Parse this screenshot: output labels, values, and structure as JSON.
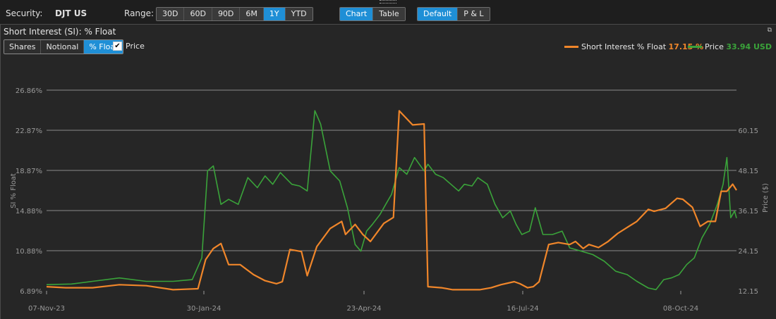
{
  "toolbar": {
    "security_label": "Security:",
    "security_value": "DJT US",
    "range_label": "Range:",
    "ranges": [
      "30D",
      "60D",
      "90D",
      "6M",
      "1Y",
      "YTD"
    ],
    "range_active": "1Y",
    "views": [
      "Chart",
      "Table"
    ],
    "view_active": "Chart",
    "modes": [
      "Default",
      "P & L"
    ],
    "mode_active": "Default"
  },
  "panel": {
    "title": "Short Interest (SI): % Float",
    "measure_buttons": [
      "Shares",
      "Notional",
      "% Float"
    ],
    "measure_active": "% Float",
    "price_checkbox_label": "Price",
    "price_checked": true,
    "restore_icon": "restore-window-icon"
  },
  "legend": {
    "si_label": "Short Interest % Float",
    "si_value": "17.15 %",
    "price_label": "Price",
    "price_value": "33.94 USD"
  },
  "colors": {
    "si": "#f0862a",
    "price": "#3aa33a",
    "accent": "#1f8fd6",
    "grid": "#7a7a7a"
  },
  "chart_data": {
    "type": "line",
    "ylabel": "SI % Float",
    "y2label": "Price ($)",
    "y_ticks": [
      "26.86%",
      "22.87%",
      "18.87%",
      "14.88%",
      "10.88%",
      "6.89%"
    ],
    "y2_ticks": [
      "60.15",
      "48.15",
      "36.15",
      "24.15",
      "12.15"
    ],
    "ylim": [
      6.89,
      26.86
    ],
    "y2lim": [
      12.15,
      72.15
    ],
    "x_ticks": [
      "07-Nov-23",
      "30-Jan-24",
      "23-Apr-24",
      "16-Jul-24",
      "08-Oct-24"
    ],
    "x_start": "2023-11-07",
    "x_end": "2024-11-01",
    "grid": true,
    "legend_position": "top-right",
    "series": [
      {
        "name": "Short Interest % Float",
        "color": "#f0862a",
        "axis": "left",
        "points": [
          [
            "2023-11-07",
            7.3
          ],
          [
            "2023-11-17",
            7.2
          ],
          [
            "2023-12-01",
            7.2
          ],
          [
            "2023-12-15",
            7.5
          ],
          [
            "2023-12-29",
            7.4
          ],
          [
            "2024-01-12",
            7.0
          ],
          [
            "2024-01-25",
            7.1
          ],
          [
            "2024-01-29",
            10.0
          ],
          [
            "2024-02-02",
            11.1
          ],
          [
            "2024-02-06",
            11.6
          ],
          [
            "2024-02-10",
            9.5
          ],
          [
            "2024-02-16",
            9.5
          ],
          [
            "2024-02-23",
            8.5
          ],
          [
            "2024-02-29",
            7.9
          ],
          [
            "2024-03-06",
            7.6
          ],
          [
            "2024-03-09",
            7.8
          ],
          [
            "2024-03-13",
            11.0
          ],
          [
            "2024-03-19",
            10.8
          ],
          [
            "2024-03-22",
            8.4
          ],
          [
            "2024-03-27",
            11.3
          ],
          [
            "2024-04-03",
            13.1
          ],
          [
            "2024-04-09",
            13.8
          ],
          [
            "2024-04-11",
            12.5
          ],
          [
            "2024-04-16",
            13.5
          ],
          [
            "2024-04-20",
            12.5
          ],
          [
            "2024-04-24",
            11.8
          ],
          [
            "2024-05-01",
            13.6
          ],
          [
            "2024-05-06",
            14.2
          ],
          [
            "2024-05-09",
            24.8
          ],
          [
            "2024-05-16",
            23.4
          ],
          [
            "2024-05-22",
            23.5
          ],
          [
            "2024-05-24",
            7.3
          ],
          [
            "2024-05-31",
            7.2
          ],
          [
            "2024-06-06",
            7.0
          ],
          [
            "2024-06-12",
            7.0
          ],
          [
            "2024-06-20",
            7.0
          ],
          [
            "2024-06-26",
            7.2
          ],
          [
            "2024-07-01",
            7.5
          ],
          [
            "2024-07-08",
            7.8
          ],
          [
            "2024-07-11",
            7.6
          ],
          [
            "2024-07-15",
            7.2
          ],
          [
            "2024-07-18",
            7.3
          ],
          [
            "2024-07-21",
            7.8
          ],
          [
            "2024-07-26",
            11.5
          ],
          [
            "2024-07-31",
            11.7
          ],
          [
            "2024-08-06",
            11.5
          ],
          [
            "2024-08-09",
            11.8
          ],
          [
            "2024-08-13",
            11.1
          ],
          [
            "2024-08-16",
            11.5
          ],
          [
            "2024-08-21",
            11.2
          ],
          [
            "2024-08-26",
            11.8
          ],
          [
            "2024-08-31",
            12.6
          ],
          [
            "2024-09-05",
            13.2
          ],
          [
            "2024-09-10",
            13.8
          ],
          [
            "2024-09-16",
            15.0
          ],
          [
            "2024-09-19",
            14.8
          ],
          [
            "2024-09-25",
            15.1
          ],
          [
            "2024-10-01",
            16.1
          ],
          [
            "2024-10-04",
            16.0
          ],
          [
            "2024-10-09",
            15.2
          ],
          [
            "2024-10-13",
            13.3
          ],
          [
            "2024-10-17",
            13.8
          ],
          [
            "2024-10-21",
            13.8
          ],
          [
            "2024-10-24",
            16.8
          ],
          [
            "2024-10-27",
            16.8
          ],
          [
            "2024-10-30",
            17.5
          ],
          [
            "2024-11-01",
            16.9
          ]
        ]
      },
      {
        "name": "Price",
        "color": "#3aa33a",
        "axis": "right",
        "points": [
          [
            "2023-11-07",
            14.0
          ],
          [
            "2023-11-20",
            14.2
          ],
          [
            "2023-12-01",
            15.0
          ],
          [
            "2023-12-15",
            16.0
          ],
          [
            "2023-12-29",
            15.0
          ],
          [
            "2024-01-12",
            15.0
          ],
          [
            "2024-01-22",
            15.5
          ],
          [
            "2024-01-27",
            22.0
          ],
          [
            "2024-01-30",
            48.0
          ],
          [
            "2024-02-02",
            49.5
          ],
          [
            "2024-02-06",
            38.0
          ],
          [
            "2024-02-10",
            39.5
          ],
          [
            "2024-02-15",
            38.0
          ],
          [
            "2024-02-20",
            46.0
          ],
          [
            "2024-02-25",
            43.0
          ],
          [
            "2024-02-29",
            46.5
          ],
          [
            "2024-03-04",
            44.0
          ],
          [
            "2024-03-08",
            47.5
          ],
          [
            "2024-03-14",
            44.0
          ],
          [
            "2024-03-18",
            43.5
          ],
          [
            "2024-03-22",
            42.0
          ],
          [
            "2024-03-26",
            66.0
          ],
          [
            "2024-03-29",
            62.0
          ],
          [
            "2024-04-03",
            48.0
          ],
          [
            "2024-04-08",
            45.0
          ],
          [
            "2024-04-12",
            37.0
          ],
          [
            "2024-04-16",
            26.0
          ],
          [
            "2024-04-19",
            24.0
          ],
          [
            "2024-04-22",
            30.0
          ],
          [
            "2024-04-25",
            32.0
          ],
          [
            "2024-04-29",
            35.0
          ],
          [
            "2024-05-02",
            38.0
          ],
          [
            "2024-05-05",
            41.0
          ],
          [
            "2024-05-09",
            49.0
          ],
          [
            "2024-05-13",
            47.0
          ],
          [
            "2024-05-17",
            52.0
          ],
          [
            "2024-05-22",
            48.0
          ],
          [
            "2024-05-24",
            50.0
          ],
          [
            "2024-05-28",
            47.0
          ],
          [
            "2024-06-01",
            46.0
          ],
          [
            "2024-06-05",
            44.0
          ],
          [
            "2024-06-09",
            42.0
          ],
          [
            "2024-06-12",
            44.0
          ],
          [
            "2024-06-16",
            43.5
          ],
          [
            "2024-06-19",
            46.0
          ],
          [
            "2024-06-24",
            44.0
          ],
          [
            "2024-06-28",
            38.0
          ],
          [
            "2024-07-02",
            34.0
          ],
          [
            "2024-07-06",
            36.0
          ],
          [
            "2024-07-09",
            32.0
          ],
          [
            "2024-07-12",
            29.0
          ],
          [
            "2024-07-16",
            30.0
          ],
          [
            "2024-07-19",
            37.0
          ],
          [
            "2024-07-23",
            29.0
          ],
          [
            "2024-07-28",
            29.0
          ],
          [
            "2024-08-02",
            30.0
          ],
          [
            "2024-08-06",
            25.0
          ],
          [
            "2024-08-12",
            24.0
          ],
          [
            "2024-08-18",
            23.0
          ],
          [
            "2024-08-24",
            21.0
          ],
          [
            "2024-08-30",
            18.0
          ],
          [
            "2024-09-05",
            17.0
          ],
          [
            "2024-09-10",
            15.0
          ],
          [
            "2024-09-16",
            13.0
          ],
          [
            "2024-09-20",
            12.5
          ],
          [
            "2024-09-24",
            15.5
          ],
          [
            "2024-09-28",
            16.0
          ],
          [
            "2024-10-02",
            17.0
          ],
          [
            "2024-10-06",
            20.0
          ],
          [
            "2024-10-10",
            22.0
          ],
          [
            "2024-10-14",
            28.0
          ],
          [
            "2024-10-18",
            32.0
          ],
          [
            "2024-10-22",
            38.0
          ],
          [
            "2024-10-25",
            44.0
          ],
          [
            "2024-10-27",
            52.0
          ],
          [
            "2024-10-29",
            34.0
          ],
          [
            "2024-10-31",
            36.0
          ],
          [
            "2024-11-01",
            33.9
          ]
        ]
      }
    ]
  }
}
